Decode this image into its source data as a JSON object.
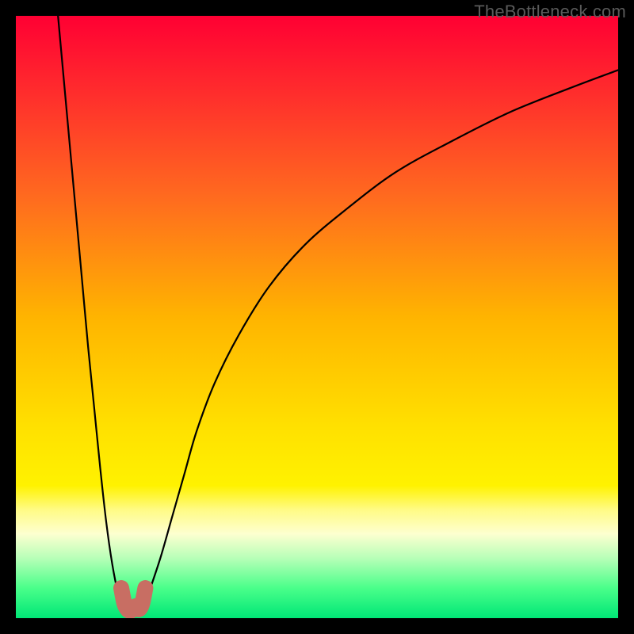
{
  "watermark": {
    "text": "TheBottleneck.com"
  },
  "chart_data": {
    "type": "line",
    "title": "",
    "xlabel": "",
    "ylabel": "",
    "xlim": [
      0,
      100
    ],
    "ylim": [
      0,
      100
    ],
    "legend": false,
    "grid": false,
    "background_gradient_stops": [
      {
        "offset": 0.0,
        "color": "#ff0033"
      },
      {
        "offset": 0.12,
        "color": "#ff2a2d"
      },
      {
        "offset": 0.3,
        "color": "#ff6a1f"
      },
      {
        "offset": 0.5,
        "color": "#ffb400"
      },
      {
        "offset": 0.68,
        "color": "#ffe000"
      },
      {
        "offset": 0.78,
        "color": "#fff200"
      },
      {
        "offset": 0.82,
        "color": "#fffb85"
      },
      {
        "offset": 0.86,
        "color": "#fdffd0"
      },
      {
        "offset": 0.9,
        "color": "#b8ffb8"
      },
      {
        "offset": 0.95,
        "color": "#4aff8a"
      },
      {
        "offset": 1.0,
        "color": "#00e676"
      }
    ],
    "series": [
      {
        "name": "left-branch",
        "color": "#000000",
        "x": [
          7,
          8,
          9,
          10,
          11,
          12,
          13,
          14,
          15,
          16,
          17,
          18
        ],
        "y": [
          100,
          89,
          78,
          67,
          56,
          45,
          35,
          25,
          16,
          9,
          4,
          1
        ]
      },
      {
        "name": "right-branch",
        "color": "#000000",
        "x": [
          21,
          22,
          24,
          26,
          28,
          30,
          33,
          37,
          42,
          48,
          55,
          63,
          72,
          82,
          92,
          100
        ],
        "y": [
          1,
          4,
          10,
          17,
          24,
          31,
          39,
          47,
          55,
          62,
          68,
          74,
          79,
          84,
          88,
          91
        ]
      },
      {
        "name": "u-blob",
        "color": "#c86e63",
        "note": "decorative thick U-shaped marker at trough",
        "x": [
          17.5,
          18.0,
          18.5,
          19.0,
          19.5,
          20.0,
          20.5,
          21.0,
          21.5
        ],
        "y": [
          5.0,
          2.5,
          1.5,
          1.2,
          1.5,
          2.0,
          1.5,
          2.5,
          5.0
        ]
      }
    ]
  }
}
